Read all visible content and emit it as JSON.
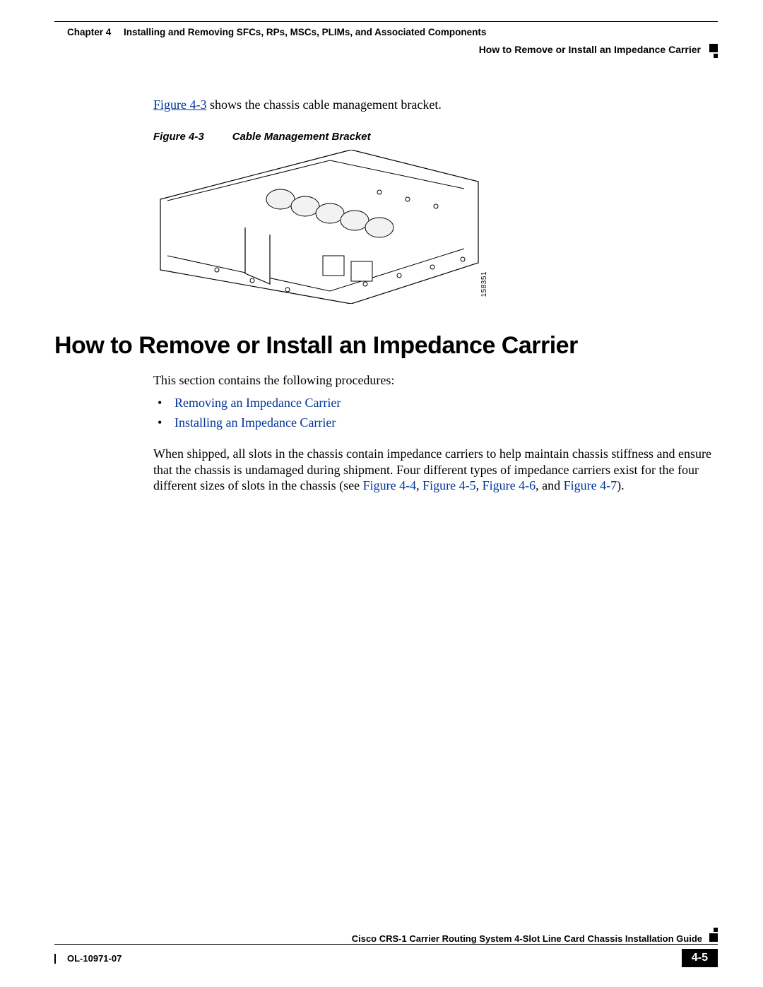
{
  "header": {
    "chapter_label": "Chapter 4",
    "chapter_title": "Installing and Removing SFCs, RPs, MSCs, PLIMs, and Associated Components",
    "section_name": "How to Remove or Install an Impedance Carrier"
  },
  "body": {
    "intro_link": "Figure 4-3",
    "intro_rest": " shows the chassis cable management bracket.",
    "figure_caption_num": "Figure 4-3",
    "figure_caption_title": "Cable Management Bracket",
    "figure_id": "158351",
    "main_heading": "How to Remove or Install an Impedance Carrier",
    "proc_intro": "This section contains the following procedures:",
    "bullets": [
      "Removing an Impedance Carrier",
      "Installing an Impedance Carrier"
    ],
    "para2_pre": "When shipped, all slots in the chassis contain impedance carriers to help maintain chassis stiffness and ensure that the chassis is undamaged during shipment. Four different types of impedance carriers exist for the four different sizes of slots in the chassis (see ",
    "fig44": "Figure 4-4",
    "sep1": ", ",
    "fig45": "Figure 4-5",
    "sep2": ", ",
    "fig46": "Figure 4-6",
    "sep3": ", and ",
    "fig47": "Figure 4-7",
    "para2_post": ")."
  },
  "footer": {
    "doc_title": "Cisco CRS-1 Carrier Routing System 4-Slot Line Card Chassis Installation Guide",
    "doc_number": "OL-10971-07",
    "page_number": "4-5"
  }
}
